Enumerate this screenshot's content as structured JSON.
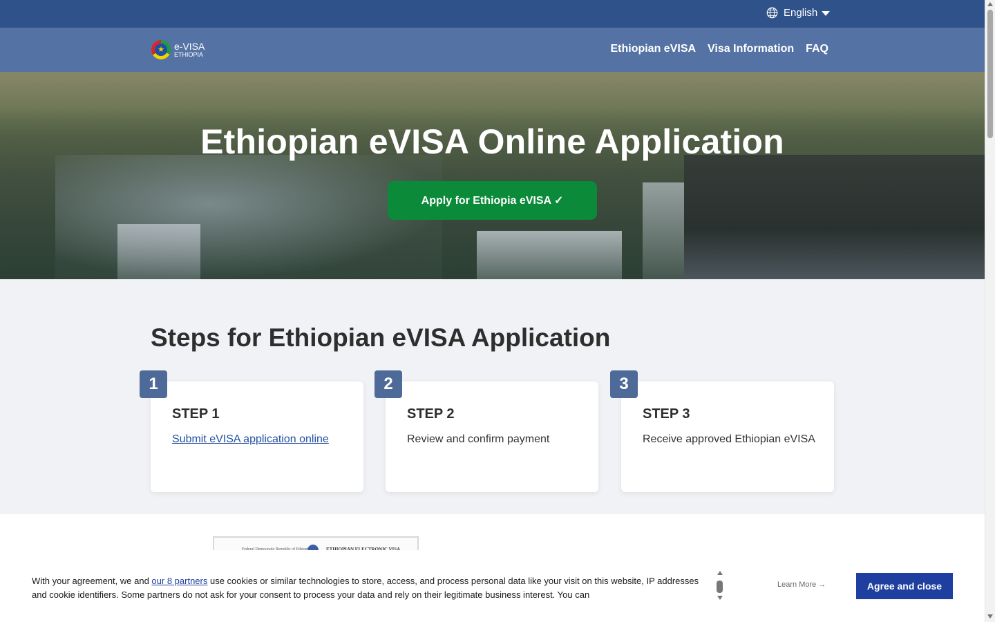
{
  "topbar": {
    "language_label": "English",
    "globe_icon": "globe-icon",
    "caret_icon": "caret-down-icon",
    "background": "#2f528a"
  },
  "navbar": {
    "logo_line1": "e-VISA",
    "logo_line2": "ETHIOPIA",
    "links": [
      "Ethiopian eVISA",
      "Visa Information",
      "FAQ"
    ],
    "background": "#5473a4"
  },
  "hero": {
    "title": "Ethiopian eVISA Online Application",
    "apply_button": "Apply for Ethiopia eVISA ✓",
    "button_color": "#0b8a3a"
  },
  "steps": {
    "heading": "Steps for Ethiopian eVISA Application",
    "items": [
      {
        "number": "1",
        "title": "STEP 1",
        "description": "Submit eVISA application online",
        "is_link": true
      },
      {
        "number": "2",
        "title": "STEP 2",
        "description": "Review and confirm payment",
        "is_link": false
      },
      {
        "number": "3",
        "title": "STEP 3",
        "description": "Receive approved Ethiopian eVISA",
        "is_link": false
      }
    ],
    "badge_color": "#4d6a99"
  },
  "document_preview": {
    "line1": "Federal Democratic Republic of Ethiopia",
    "line2": "ETHIOPIAN ELECTRONIC VISA"
  },
  "consent": {
    "text_before_link": "With your agreement, we and ",
    "partners_link": "our 8 partners",
    "text_after_link": " use cookies or similar technologies to store, access, and process personal data like your visit on this website, IP addresses and cookie identifiers. Some partners do not ask for your consent to process your data and rely on their legitimate business interest. You can",
    "learn_more": "Learn More →",
    "agree_button": "Agree and close",
    "agree_color": "#1f3fa0"
  }
}
